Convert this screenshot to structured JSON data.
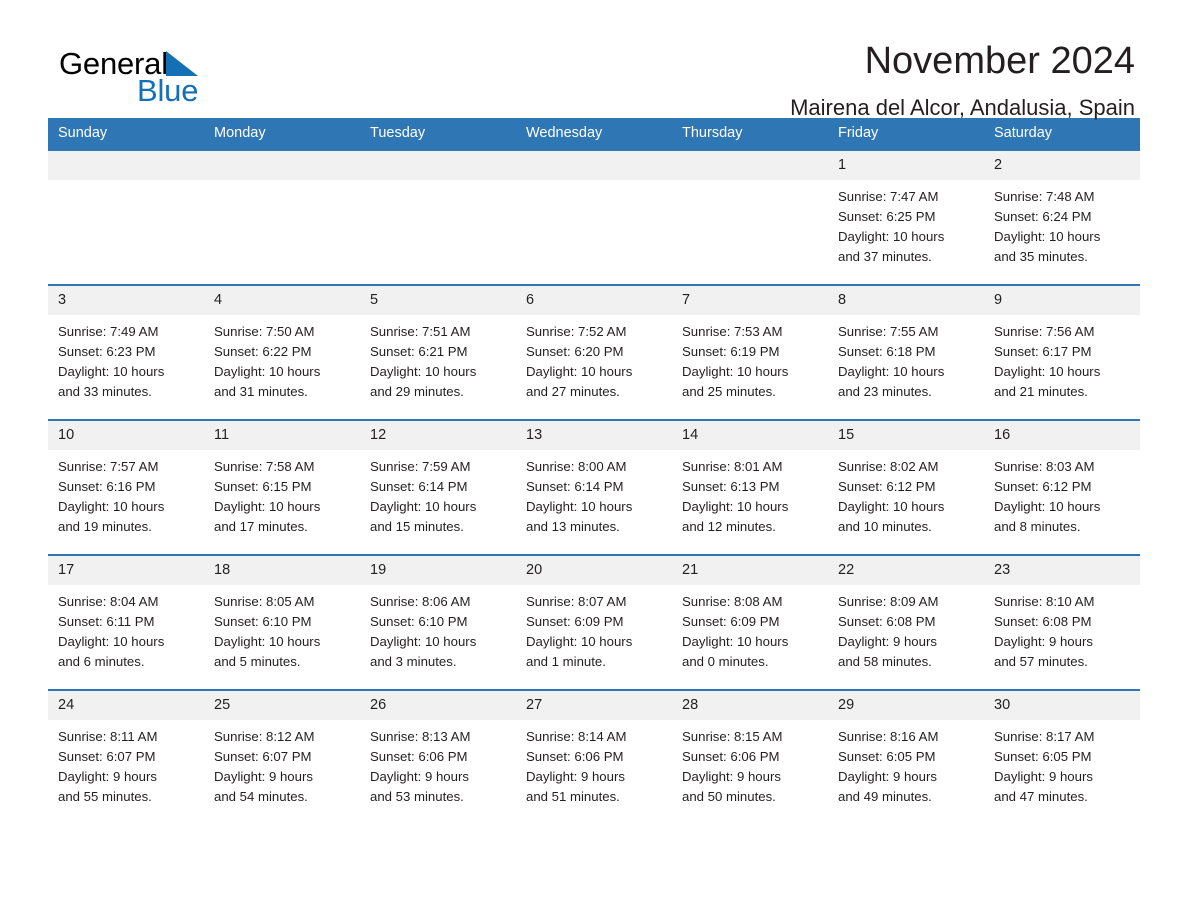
{
  "brand": {
    "name_part1": "General",
    "name_part2": "Blue",
    "accent_color": "#1470b4"
  },
  "header": {
    "title": "November 2024",
    "subtitle": "Mairena del Alcor, Andalusia, Spain"
  },
  "calendar": {
    "header_color": "#2f76b4",
    "daynum_band_color": "#f1f1f1",
    "weekdays": [
      "Sunday",
      "Monday",
      "Tuesday",
      "Wednesday",
      "Thursday",
      "Friday",
      "Saturday"
    ],
    "weeks": [
      [
        {
          "day": "",
          "lines": []
        },
        {
          "day": "",
          "lines": []
        },
        {
          "day": "",
          "lines": []
        },
        {
          "day": "",
          "lines": []
        },
        {
          "day": "",
          "lines": []
        },
        {
          "day": "1",
          "lines": [
            "Sunrise: 7:47 AM",
            "Sunset: 6:25 PM",
            "Daylight: 10 hours",
            "and 37 minutes."
          ]
        },
        {
          "day": "2",
          "lines": [
            "Sunrise: 7:48 AM",
            "Sunset: 6:24 PM",
            "Daylight: 10 hours",
            "and 35 minutes."
          ]
        }
      ],
      [
        {
          "day": "3",
          "lines": [
            "Sunrise: 7:49 AM",
            "Sunset: 6:23 PM",
            "Daylight: 10 hours",
            "and 33 minutes."
          ]
        },
        {
          "day": "4",
          "lines": [
            "Sunrise: 7:50 AM",
            "Sunset: 6:22 PM",
            "Daylight: 10 hours",
            "and 31 minutes."
          ]
        },
        {
          "day": "5",
          "lines": [
            "Sunrise: 7:51 AM",
            "Sunset: 6:21 PM",
            "Daylight: 10 hours",
            "and 29 minutes."
          ]
        },
        {
          "day": "6",
          "lines": [
            "Sunrise: 7:52 AM",
            "Sunset: 6:20 PM",
            "Daylight: 10 hours",
            "and 27 minutes."
          ]
        },
        {
          "day": "7",
          "lines": [
            "Sunrise: 7:53 AM",
            "Sunset: 6:19 PM",
            "Daylight: 10 hours",
            "and 25 minutes."
          ]
        },
        {
          "day": "8",
          "lines": [
            "Sunrise: 7:55 AM",
            "Sunset: 6:18 PM",
            "Daylight: 10 hours",
            "and 23 minutes."
          ]
        },
        {
          "day": "9",
          "lines": [
            "Sunrise: 7:56 AM",
            "Sunset: 6:17 PM",
            "Daylight: 10 hours",
            "and 21 minutes."
          ]
        }
      ],
      [
        {
          "day": "10",
          "lines": [
            "Sunrise: 7:57 AM",
            "Sunset: 6:16 PM",
            "Daylight: 10 hours",
            "and 19 minutes."
          ]
        },
        {
          "day": "11",
          "lines": [
            "Sunrise: 7:58 AM",
            "Sunset: 6:15 PM",
            "Daylight: 10 hours",
            "and 17 minutes."
          ]
        },
        {
          "day": "12",
          "lines": [
            "Sunrise: 7:59 AM",
            "Sunset: 6:14 PM",
            "Daylight: 10 hours",
            "and 15 minutes."
          ]
        },
        {
          "day": "13",
          "lines": [
            "Sunrise: 8:00 AM",
            "Sunset: 6:14 PM",
            "Daylight: 10 hours",
            "and 13 minutes."
          ]
        },
        {
          "day": "14",
          "lines": [
            "Sunrise: 8:01 AM",
            "Sunset: 6:13 PM",
            "Daylight: 10 hours",
            "and 12 minutes."
          ]
        },
        {
          "day": "15",
          "lines": [
            "Sunrise: 8:02 AM",
            "Sunset: 6:12 PM",
            "Daylight: 10 hours",
            "and 10 minutes."
          ]
        },
        {
          "day": "16",
          "lines": [
            "Sunrise: 8:03 AM",
            "Sunset: 6:12 PM",
            "Daylight: 10 hours",
            "and 8 minutes."
          ]
        }
      ],
      [
        {
          "day": "17",
          "lines": [
            "Sunrise: 8:04 AM",
            "Sunset: 6:11 PM",
            "Daylight: 10 hours",
            "and 6 minutes."
          ]
        },
        {
          "day": "18",
          "lines": [
            "Sunrise: 8:05 AM",
            "Sunset: 6:10 PM",
            "Daylight: 10 hours",
            "and 5 minutes."
          ]
        },
        {
          "day": "19",
          "lines": [
            "Sunrise: 8:06 AM",
            "Sunset: 6:10 PM",
            "Daylight: 10 hours",
            "and 3 minutes."
          ]
        },
        {
          "day": "20",
          "lines": [
            "Sunrise: 8:07 AM",
            "Sunset: 6:09 PM",
            "Daylight: 10 hours",
            "and 1 minute."
          ]
        },
        {
          "day": "21",
          "lines": [
            "Sunrise: 8:08 AM",
            "Sunset: 6:09 PM",
            "Daylight: 10 hours",
            "and 0 minutes."
          ]
        },
        {
          "day": "22",
          "lines": [
            "Sunrise: 8:09 AM",
            "Sunset: 6:08 PM",
            "Daylight: 9 hours",
            "and 58 minutes."
          ]
        },
        {
          "day": "23",
          "lines": [
            "Sunrise: 8:10 AM",
            "Sunset: 6:08 PM",
            "Daylight: 9 hours",
            "and 57 minutes."
          ]
        }
      ],
      [
        {
          "day": "24",
          "lines": [
            "Sunrise: 8:11 AM",
            "Sunset: 6:07 PM",
            "Daylight: 9 hours",
            "and 55 minutes."
          ]
        },
        {
          "day": "25",
          "lines": [
            "Sunrise: 8:12 AM",
            "Sunset: 6:07 PM",
            "Daylight: 9 hours",
            "and 54 minutes."
          ]
        },
        {
          "day": "26",
          "lines": [
            "Sunrise: 8:13 AM",
            "Sunset: 6:06 PM",
            "Daylight: 9 hours",
            "and 53 minutes."
          ]
        },
        {
          "day": "27",
          "lines": [
            "Sunrise: 8:14 AM",
            "Sunset: 6:06 PM",
            "Daylight: 9 hours",
            "and 51 minutes."
          ]
        },
        {
          "day": "28",
          "lines": [
            "Sunrise: 8:15 AM",
            "Sunset: 6:06 PM",
            "Daylight: 9 hours",
            "and 50 minutes."
          ]
        },
        {
          "day": "29",
          "lines": [
            "Sunrise: 8:16 AM",
            "Sunset: 6:05 PM",
            "Daylight: 9 hours",
            "and 49 minutes."
          ]
        },
        {
          "day": "30",
          "lines": [
            "Sunrise: 8:17 AM",
            "Sunset: 6:05 PM",
            "Daylight: 9 hours",
            "and 47 minutes."
          ]
        }
      ]
    ]
  }
}
